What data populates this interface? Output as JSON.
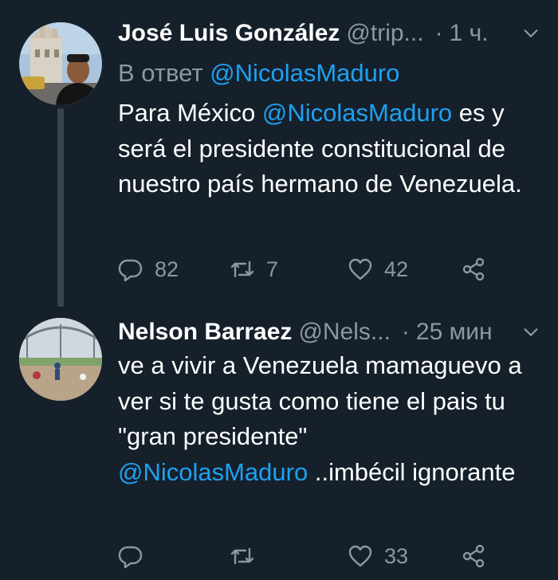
{
  "tweets": [
    {
      "author_name": "José Luis González",
      "handle": "@trip...",
      "separator": "·",
      "time": "1 ч.",
      "reply_prefix": "В ответ",
      "reply_to": "@NicolasMaduro",
      "text_before": "Para México",
      "text_mention": "@NicolasMaduro",
      "text_after": "es y será el presidente constitucional de nuestro país hermano de Venezuela.",
      "reply_count": "82",
      "retweet_count": "7",
      "like_count": "42"
    },
    {
      "author_name": "Nelson Barraez",
      "handle": "@Nels...",
      "separator": "·",
      "time": "25 мин",
      "text_before": "ve a vivir a Venezuela mamaguevo a ver si te gusta como tiene el pais tu \"gran presidente\"",
      "text_mention": "@NicolasMaduro",
      "text_after": "..imbécil ignorante",
      "like_count": "33"
    }
  ],
  "colors": {
    "background": "#15202b",
    "text": "#ffffff",
    "secondary": "#8899a6",
    "link": "#1da1f2",
    "thread_line": "#38444d"
  },
  "icons": {
    "reply": "reply-bubble-icon",
    "retweet": "retweet-arrows-icon",
    "like": "heart-icon",
    "share": "share-nodes-icon",
    "menu": "chevron-down-icon"
  }
}
